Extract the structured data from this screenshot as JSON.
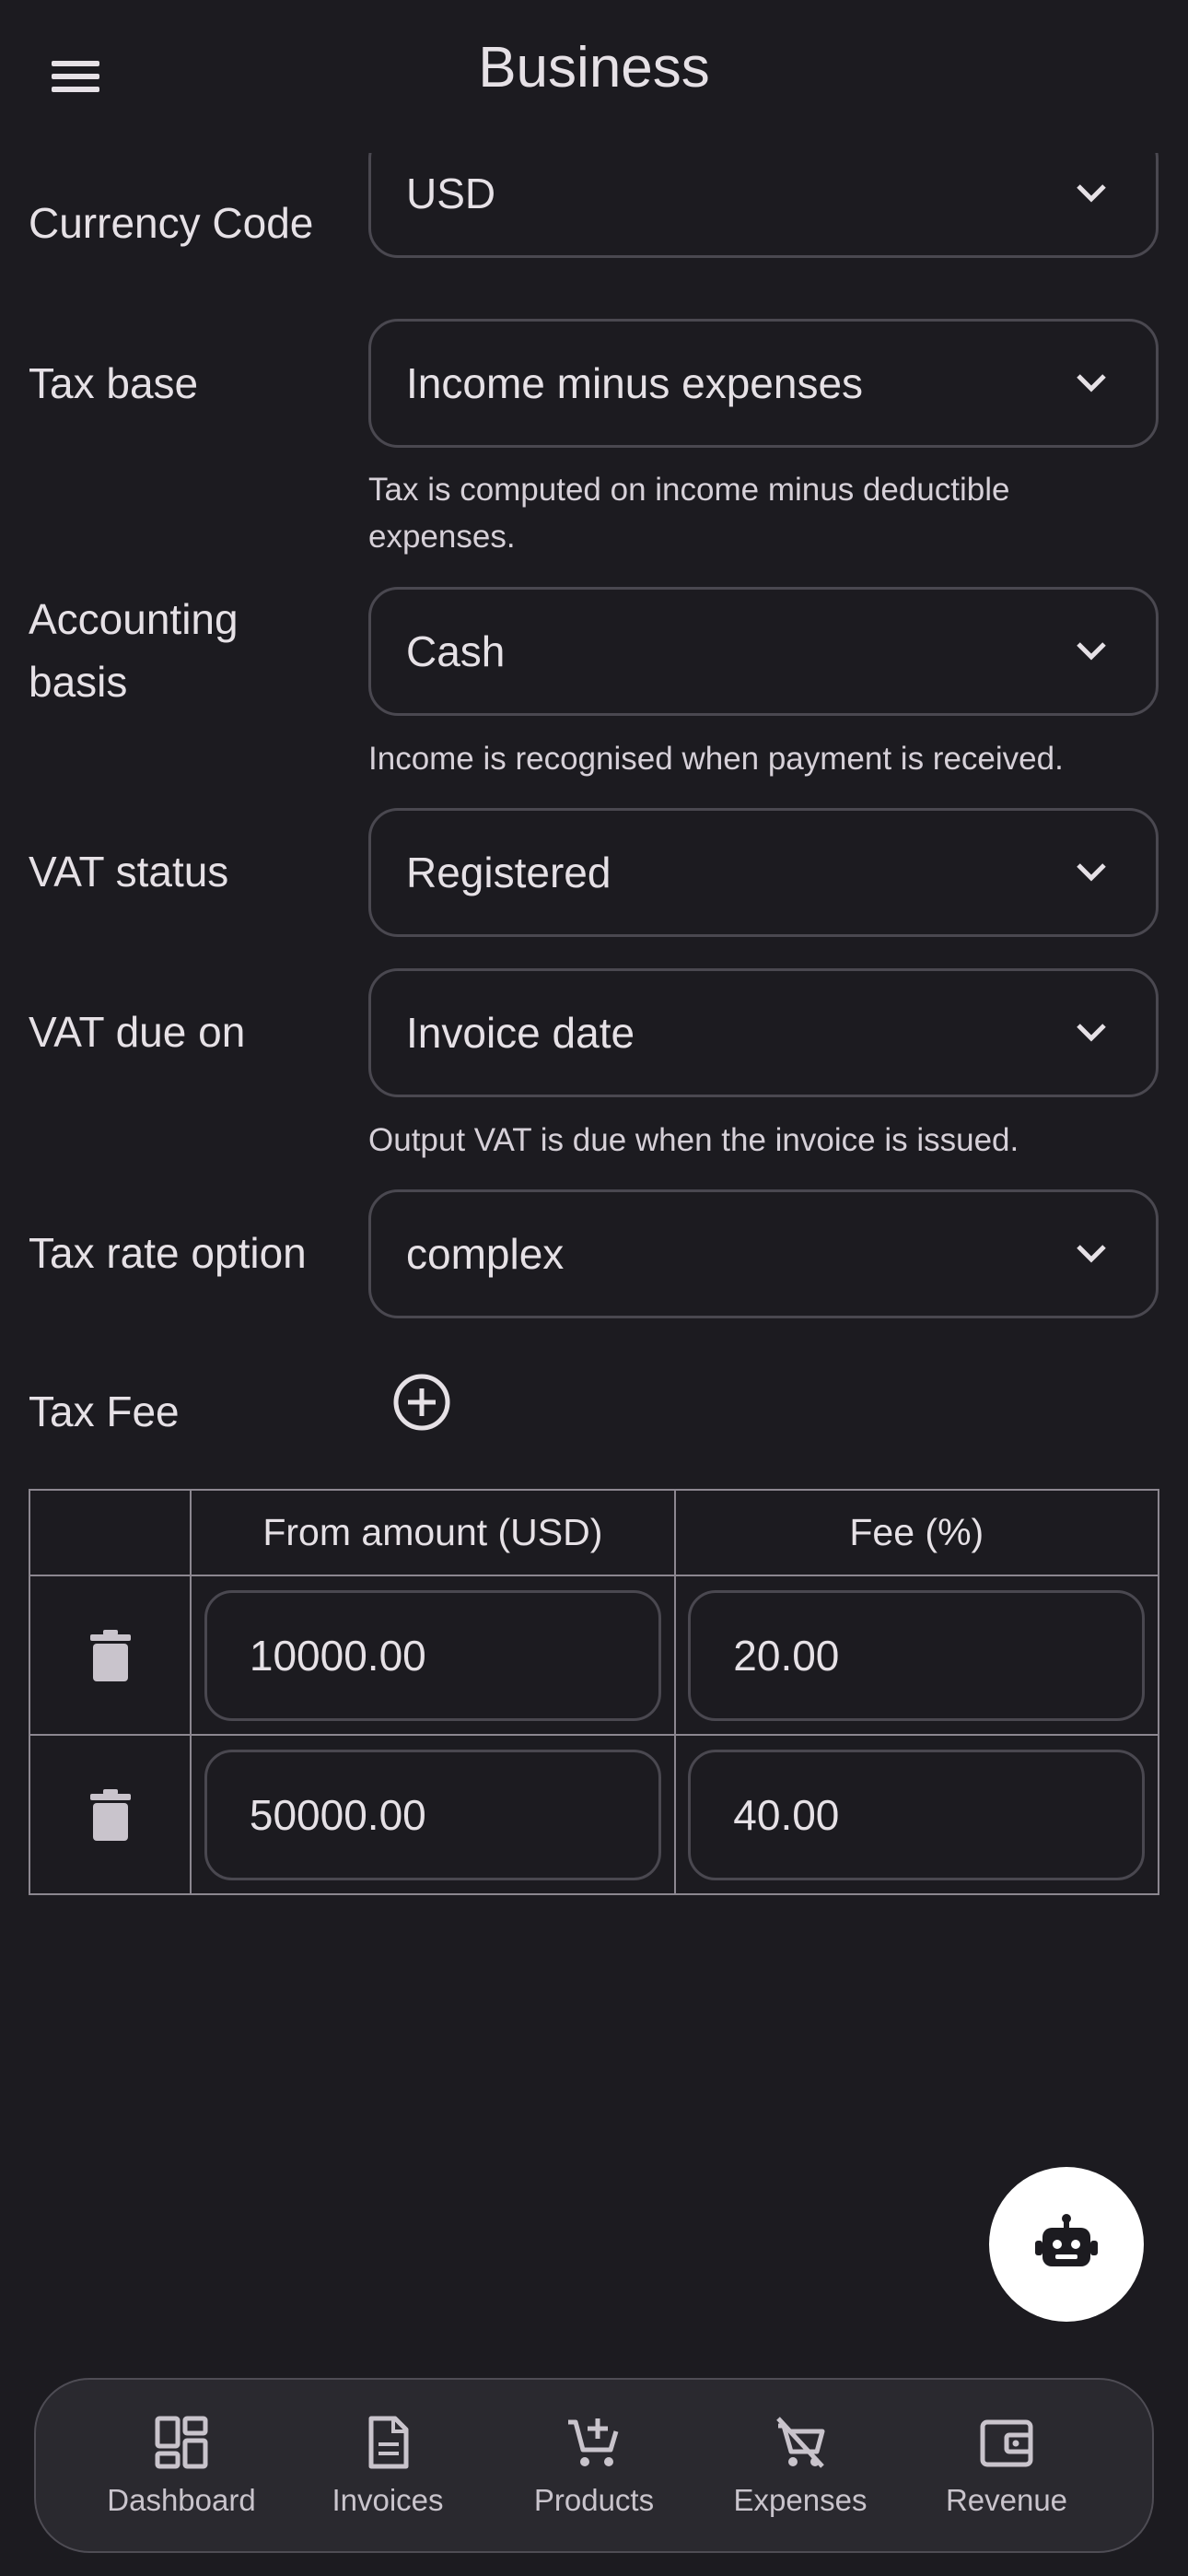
{
  "app": {
    "title": "Business"
  },
  "form": {
    "currency": {
      "label": "Currency Code",
      "value": "USD"
    },
    "tax_base": {
      "label": "Tax base",
      "value": "Income minus expenses",
      "helper": "Tax is computed on income minus deductible expenses."
    },
    "accounting_basis": {
      "label_line1": "Accounting",
      "label_line2": "basis",
      "value": "Cash",
      "helper": "Income is recognised when payment is received."
    },
    "vat_status": {
      "label": "VAT status",
      "value": "Registered"
    },
    "vat_due_on": {
      "label": "VAT due on",
      "value": "Invoice date",
      "helper": "Output VAT is due when the invoice is issued."
    },
    "tax_rate_option": {
      "label": "Tax rate option",
      "value": "complex"
    }
  },
  "tax_fee": {
    "label": "Tax Fee",
    "columns": [
      "",
      "From amount (USD)",
      "Fee (%)"
    ],
    "rows": [
      {
        "from_amount": "10000.00",
        "fee": "20.00"
      },
      {
        "from_amount": "50000.00",
        "fee": "40.00"
      }
    ]
  },
  "fab": {
    "icon": "robot-icon"
  },
  "bottom_nav": [
    {
      "label": "Dashboard",
      "icon": "dashboard-icon"
    },
    {
      "label": "Invoices",
      "icon": "invoice-icon"
    },
    {
      "label": "Products",
      "icon": "add-cart-icon"
    },
    {
      "label": "Expenses",
      "icon": "remove-cart-icon"
    },
    {
      "label": "Revenue",
      "icon": "wallet-icon"
    }
  ],
  "colors": {
    "background": "#1c1b20",
    "text": "#e6e1e6",
    "outline": "#4a4850",
    "nav_background": "#2a292f",
    "fab": "#ffffff"
  }
}
